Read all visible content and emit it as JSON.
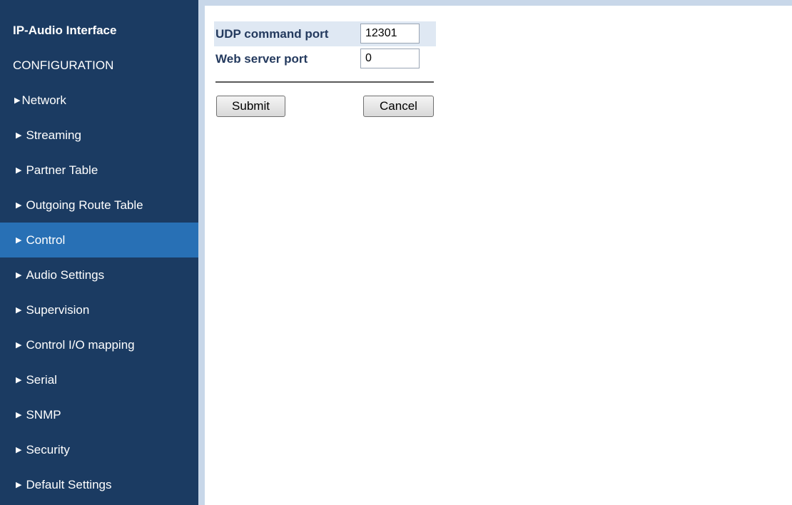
{
  "sidebar": {
    "app_title": "IP-Audio Interface",
    "section_label": "CONFIGURATION",
    "items": [
      {
        "label": "Network"
      },
      {
        "label": "Streaming"
      },
      {
        "label": "Partner Table"
      },
      {
        "label": "Outgoing Route Table"
      },
      {
        "label": "Control",
        "active": true
      },
      {
        "label": "Audio Settings"
      },
      {
        "label": "Supervision"
      },
      {
        "label": "Control I/O mapping"
      },
      {
        "label": "Serial"
      },
      {
        "label": "SNMP"
      },
      {
        "label": "Security"
      },
      {
        "label": "Default Settings"
      }
    ]
  },
  "form": {
    "udp_command_port": {
      "label": "UDP command port",
      "value": "12301"
    },
    "web_server_port": {
      "label": "Web server port",
      "value": "0"
    },
    "submit_label": "Submit",
    "cancel_label": "Cancel"
  },
  "colors": {
    "sidebar_bg": "#1b3b62",
    "active_item_bg": "#2870b5",
    "accent_strip": "#c8d7e9"
  }
}
